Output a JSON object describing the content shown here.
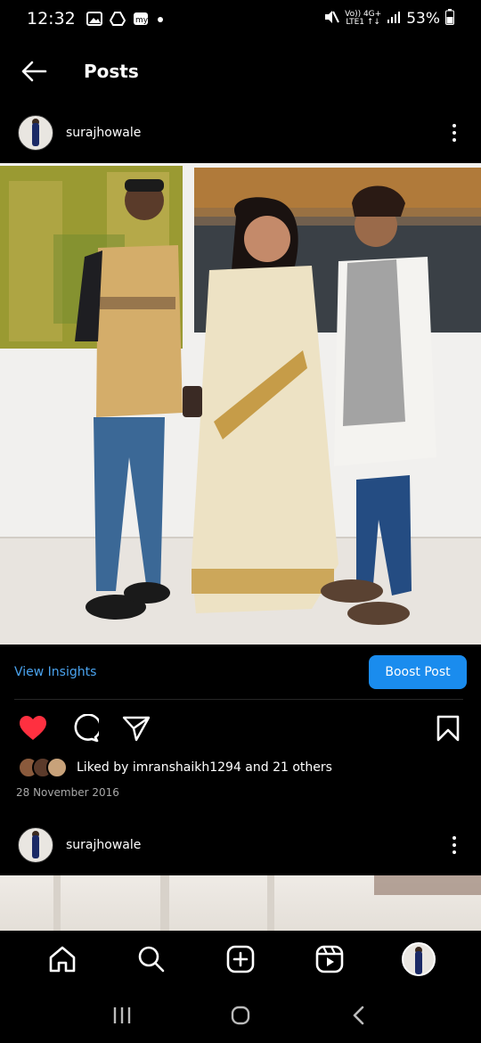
{
  "status_bar": {
    "time": "12:32",
    "battery": "53%",
    "network_top": "Vo)) 4G+",
    "network_bottom": "LTE1 ↑↓",
    "icons": [
      "image-icon",
      "drive-icon",
      "myjio-icon",
      "dot-icon",
      "mute-icon",
      "signal-icon",
      "battery-icon"
    ]
  },
  "header": {
    "title": "Posts",
    "back_icon": "arrow-left-icon"
  },
  "post": {
    "username": "surajhowale",
    "view_insights": "View Insights",
    "boost_post": "Boost Post",
    "likes_text": "Liked by imranshaikh1294 and 21 others",
    "date": "28 November 2016",
    "liked": true,
    "colors": {
      "heart": "#ff3040",
      "link": "#4aa3ef",
      "boost": "#1a8cee"
    }
  },
  "next_post": {
    "username": "surajhowale"
  },
  "bottom_nav": {
    "items": [
      "home-icon",
      "search-icon",
      "create-icon",
      "reels-icon",
      "profile-avatar"
    ]
  },
  "system_nav": {
    "items": [
      "recents-icon",
      "home-circle-icon",
      "back-chevron-icon"
    ]
  }
}
